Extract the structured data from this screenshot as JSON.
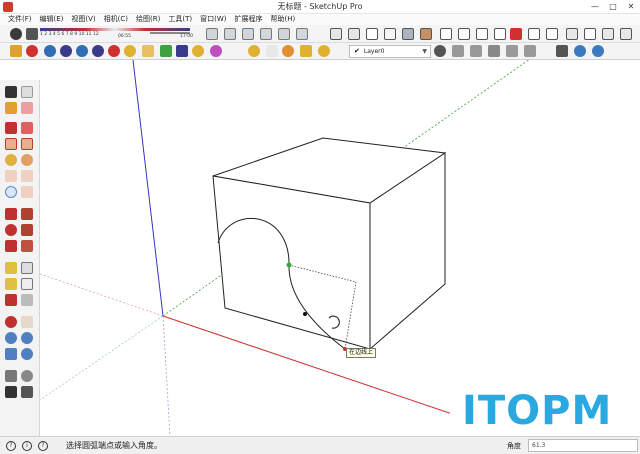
{
  "window": {
    "title": "无标题 - SketchUp Pro",
    "controls": [
      "—",
      "□",
      "✕"
    ]
  },
  "menu": [
    "文件(F)",
    "编辑(E)",
    "视图(V)",
    "相机(C)",
    "绘图(R)",
    "工具(T)",
    "窗口(W)",
    "扩展程序",
    "帮助(H)"
  ],
  "shadow_settings": {
    "months": "1 2 3 4 5 6 7 8 9 10 11 12",
    "time_start": "06:55",
    "time_end": "17:00"
  },
  "layer": {
    "current": "Layer0"
  },
  "viewport": {
    "tooltip": "在边线上"
  },
  "watermark": "ITOPM",
  "status": {
    "message": "选择圆弧端点或输入角度。",
    "measurements_label": "角度",
    "measurements_value": "61.3"
  },
  "colors": {
    "red_axis": "#d03030",
    "green_axis": "#3fa03f",
    "blue_axis": "#3535c0",
    "watermark": "#2aa8e0"
  }
}
